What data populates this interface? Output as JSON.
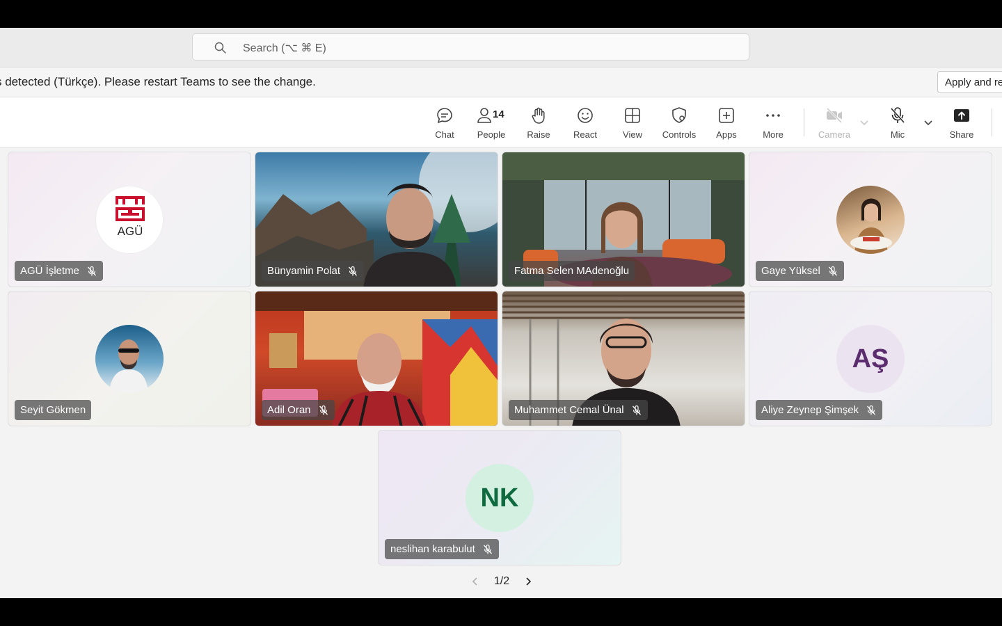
{
  "search": {
    "placeholder": "Search (⌥ ⌘ E)"
  },
  "notice": {
    "message": "s detected (Türkçe). Please restart Teams to see the change.",
    "action": "Apply and re"
  },
  "toolbar": {
    "chat": "Chat",
    "people": "People",
    "people_count": "14",
    "raise": "Raise",
    "react": "React",
    "view": "View",
    "controls": "Controls",
    "apps": "Apps",
    "more": "More",
    "camera": "Camera",
    "mic": "Mic",
    "share": "Share"
  },
  "participants": [
    {
      "name": "AGÜ İşletme",
      "muted": true,
      "logo_text": "AGÜ"
    },
    {
      "name": "Bünyamin Polat",
      "muted": true
    },
    {
      "name": "Fatma Selen MAdenoğlu",
      "muted": false
    },
    {
      "name": "Gaye Yüksel",
      "muted": true
    },
    {
      "name": "Seyit Gökmen",
      "muted": false
    },
    {
      "name": "Adil Oran",
      "muted": true
    },
    {
      "name": "Muhammet Cemal Ünal",
      "muted": true
    },
    {
      "name": "Aliye Zeynep Şimşek",
      "muted": true,
      "initials": "AŞ",
      "initials_color": "#5b2d6e",
      "avatar_bg": "#ece3f1"
    },
    {
      "name": "neslihan karabulut",
      "muted": true,
      "initials": "NK",
      "initials_color": "#0f6b3f",
      "avatar_bg": "#d3f0e1"
    }
  ],
  "pagination": {
    "label": "1/2"
  }
}
